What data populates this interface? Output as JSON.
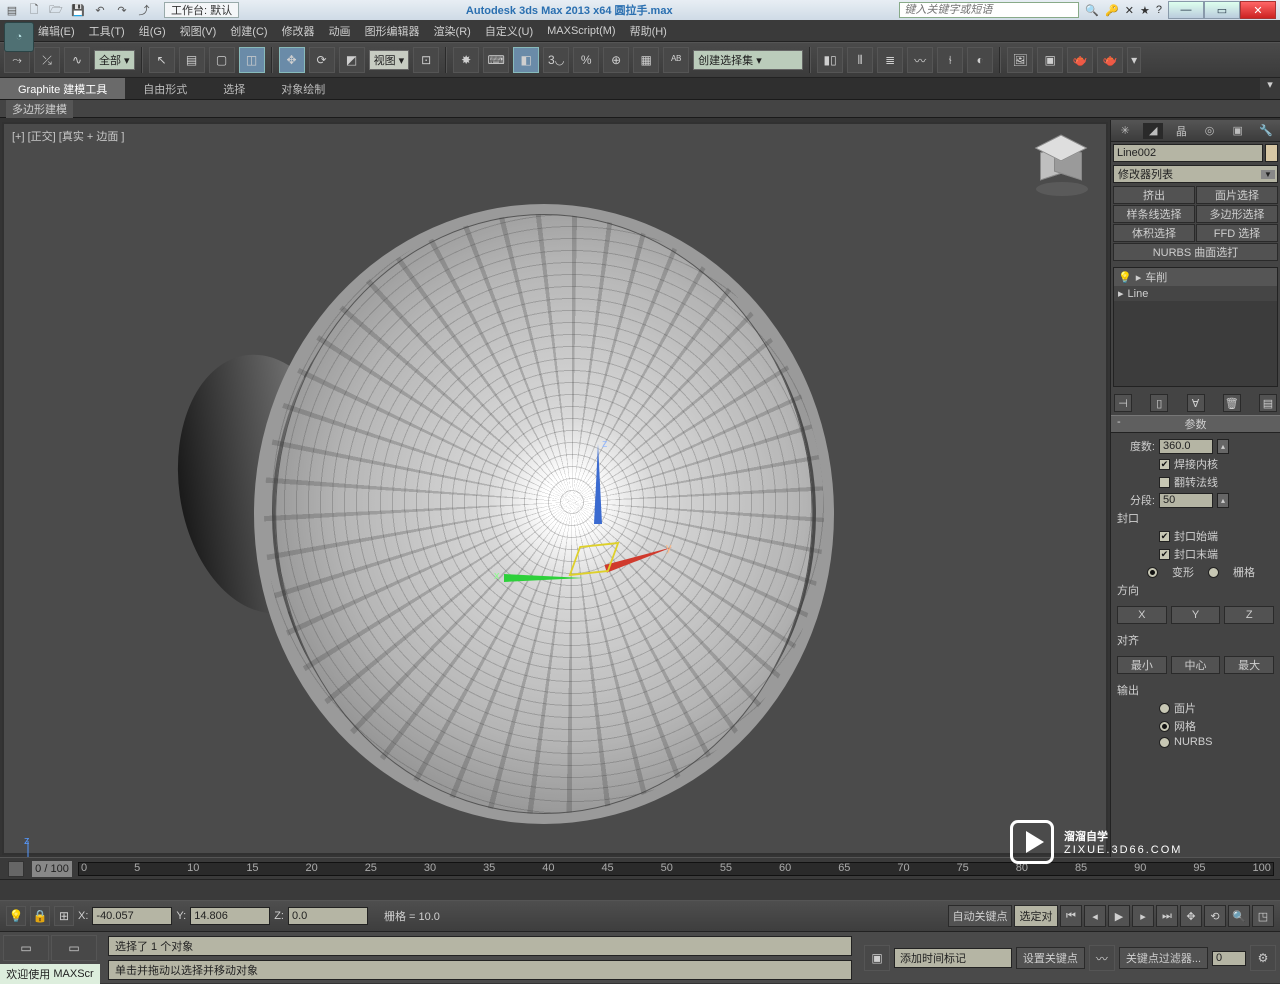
{
  "title_bar": {
    "workspace_label": "工作台: 默认",
    "app_title": "Autodesk 3ds Max  2013 x64     圆拉手.max",
    "search_placeholder": "键入关键字或短语"
  },
  "menus": [
    "编辑(E)",
    "工具(T)",
    "组(G)",
    "视图(V)",
    "创建(C)",
    "修改器",
    "动画",
    "图形编辑器",
    "渲染(R)",
    "自定义(U)",
    "MAXScript(M)",
    "帮助(H)"
  ],
  "toolbar": {
    "selection_set_label": "全部",
    "view_dropdown": "视图",
    "named_set": "创建选择集"
  },
  "ribbon_tabs": [
    "Graphite 建模工具",
    "自由形式",
    "选择",
    "对象绘制"
  ],
  "subribbon_tab": "多边形建模",
  "viewport": {
    "label": "[+] [正交] [真实 + 边面 ]",
    "axis_x": "x",
    "axis_y": "y",
    "axis_z": "z"
  },
  "side": {
    "object_name": "Line002",
    "modifier_dd": "修改器列表",
    "modifier_buttons": [
      "挤出",
      "面片选择",
      "样条线选择",
      "多边形选择",
      "体积选择",
      "FFD 选择",
      "NURBS 曲面选打"
    ],
    "stack_items": [
      {
        "icon": "💡",
        "label": "车削"
      },
      {
        "label": "Line"
      }
    ],
    "params_title": "参数",
    "degrees_label": "度数:",
    "degrees_value": "360.0",
    "weld_core": "焊接内核",
    "flip_normals": "翻转法线",
    "segments_label": "分段:",
    "segments_value": "50",
    "cap_title": "封口",
    "cap_start": "封口始端",
    "cap_end": "封口末端",
    "morph": "变形",
    "grid": "栅格",
    "direction_title": "方向",
    "dir_buttons": [
      "X",
      "Y",
      "Z"
    ],
    "align_title": "对齐",
    "align_buttons": [
      "最小",
      "中心",
      "最大"
    ],
    "output_title": "输出",
    "output_options": [
      "面片",
      "网格",
      "NURBS"
    ]
  },
  "timeline": {
    "scrub_label": "0 / 100",
    "ticks": [
      "0",
      "5",
      "10",
      "15",
      "20",
      "25",
      "30",
      "35",
      "40",
      "45",
      "50",
      "55",
      "60",
      "65",
      "70",
      "75",
      "80",
      "85",
      "90",
      "95",
      "100"
    ]
  },
  "coord": {
    "x_label": "X:",
    "x_val": "-40.057",
    "y_label": "Y:",
    "y_val": "14.806",
    "z_label": "Z:",
    "z_val": "0.0",
    "grid_label": "栅格 = 10.0",
    "auto_key": "自动关键点",
    "sel_lock": "选定对"
  },
  "bottom": {
    "status1": "选择了 1 个对象",
    "status2": "单击并拖动以选择并移动对象",
    "set_key": "设置关键点",
    "key_filter": "关键点过滤器...",
    "add_marker": "添加时间标记",
    "maxscript": "MAXScr",
    "welcome": "欢迎使用"
  },
  "watermark": {
    "main": "溜溜自学",
    "sub": "ZIXUE.3D66.COM"
  }
}
